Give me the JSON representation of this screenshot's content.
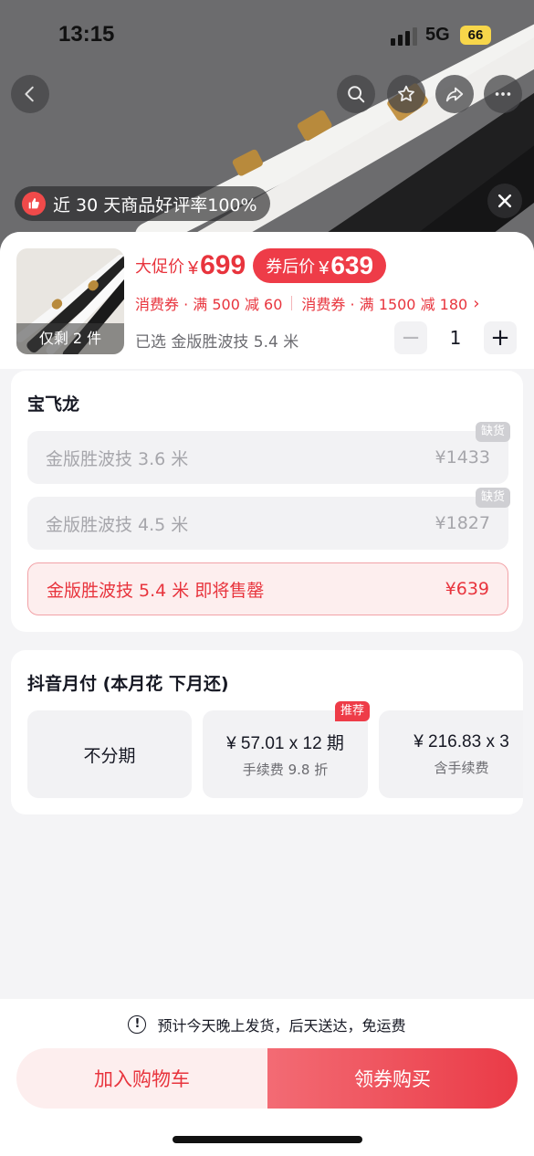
{
  "status_bar": {
    "time": "13:15",
    "network": "5G",
    "battery": "66"
  },
  "top_actions": {
    "back_icon": "chevron-left-icon",
    "search_icon": "search-icon",
    "favorite_icon": "star-icon",
    "share_icon": "share-icon",
    "more_icon": "more-icon"
  },
  "rating_banner": {
    "text": "近 30 天商品好评率100%"
  },
  "product": {
    "stock_tag": "仅剩 2 件",
    "promo_label": "大促价",
    "promo_currency": "¥",
    "promo_price": "699",
    "after_coupon_label": "券后价",
    "after_coupon_currency": "¥",
    "after_coupon_price": "639",
    "coupon_1": "消费券 · 满 500 减 60",
    "coupon_2": "消费券 · 满 1500 减 180",
    "coupon_chevron": "›",
    "selected_text": "已选 金版胜波技 5.4 米",
    "quantity": "1",
    "minus_label": "−",
    "plus_label": "+"
  },
  "variants": {
    "title": "宝飞龙",
    "options": [
      {
        "name": "金版胜波技 3.6 米",
        "price": "¥1433",
        "tag": "缺货"
      },
      {
        "name": "金版胜波技 4.5 米",
        "price": "¥1827",
        "tag": "缺货"
      },
      {
        "name": "金版胜波技 5.4 米 即将售罄",
        "price": "¥639",
        "tag": ""
      }
    ]
  },
  "installment": {
    "title": "抖音月付 (本月花 下月还)",
    "plans": [
      {
        "main": "不分期",
        "sub": ""
      },
      {
        "main": "¥ 57.01 x 12 期",
        "sub": "手续费 9.8 折",
        "badge": "推荐"
      },
      {
        "main": "¥ 216.83 x 3",
        "sub": "含手续费"
      }
    ]
  },
  "footer": {
    "shipping": "预计今天晚上发货，后天送达，免运费",
    "info_icon": "!",
    "add_to_cart": "加入购物车",
    "buy_now": "领券购买"
  },
  "colors": {
    "accent": "#ee3c48",
    "accent_light": "#fdeeee"
  }
}
